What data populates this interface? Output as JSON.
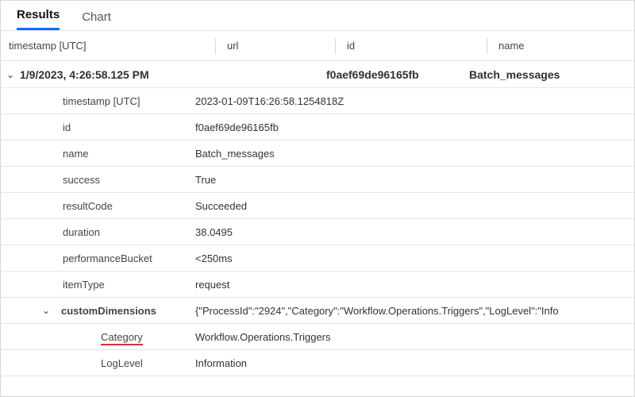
{
  "tabs": {
    "results_label": "Results",
    "chart_label": "Chart"
  },
  "columns": {
    "timestamp": "timestamp [UTC]",
    "url": "url",
    "id": "id",
    "name": "name"
  },
  "summary": {
    "timestamp": "1/9/2023, 4:26:58.125 PM",
    "url": "",
    "id": "f0aef69de96165fb",
    "name": "Batch_messages"
  },
  "detail": {
    "rows": [
      {
        "key": "timestamp [UTC]",
        "value": "2023-01-09T16:26:58.1254818Z"
      },
      {
        "key": "id",
        "value": "f0aef69de96165fb"
      },
      {
        "key": "name",
        "value": "Batch_messages"
      },
      {
        "key": "success",
        "value": "True"
      },
      {
        "key": "resultCode",
        "value": "Succeeded"
      },
      {
        "key": "duration",
        "value": "38.0495"
      },
      {
        "key": "performanceBucket",
        "value": "<250ms"
      },
      {
        "key": "itemType",
        "value": "request"
      }
    ],
    "customDimensions": {
      "label": "customDimensions",
      "raw": "{\"ProcessId\":\"2924\",\"Category\":\"Workflow.Operations.Triggers\",\"LogLevel\":\"Info",
      "nested": [
        {
          "key": "Category",
          "value": "Workflow.Operations.Triggers",
          "highlight": true
        },
        {
          "key": "LogLevel",
          "value": "Information"
        }
      ]
    }
  }
}
